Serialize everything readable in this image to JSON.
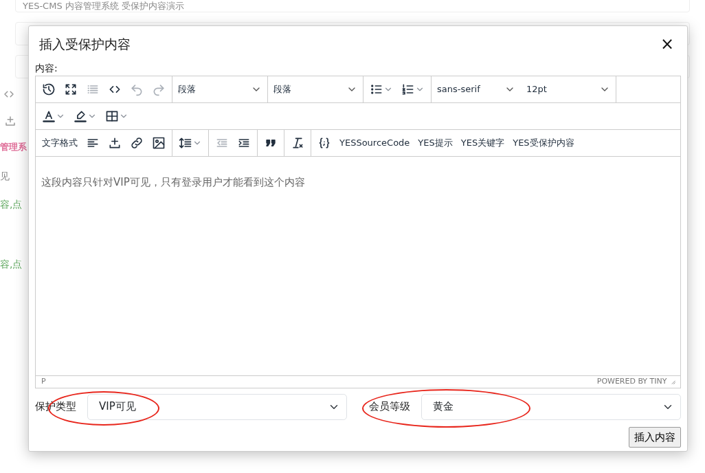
{
  "background": {
    "header": "YES-CMS 内容管理系统 受保护内容演示",
    "fragments": [
      {
        "text": "管理系",
        "color": "#e0709a"
      },
      {
        "text": "见",
        "color": "#888888"
      },
      {
        "text": "容,点",
        "color": "#5fa85f"
      },
      {
        "text": "容,点",
        "color": "#5fa85f"
      }
    ]
  },
  "dialog": {
    "title": "插入受保护内容",
    "close": "×"
  },
  "content_label": "内容:",
  "toolbar": {
    "block_format": "段落",
    "paragraph_format": "段落",
    "font_family": "sans-serif",
    "font_size": "12pt",
    "text_format": "文字格式",
    "custom_buttons": [
      "YESSourceCode",
      "YES提示",
      "YES关键字",
      "YES受保护内容"
    ],
    "disabled": {
      "list": true,
      "undo": true,
      "redo": true,
      "outdent": true
    }
  },
  "editor": {
    "text": "这段内容只针对VIP可见，只有登录用户才能看到这个内容",
    "path": "P",
    "branding": "POWERED BY TINY"
  },
  "protection_type": {
    "label": "保护类型",
    "value": "VIP可见"
  },
  "member_level": {
    "label": "会员等级",
    "value": "黄金"
  },
  "submit": "插入内容",
  "annotations": [
    {
      "kind": "ellipse"
    },
    {
      "kind": "ellipse"
    }
  ]
}
